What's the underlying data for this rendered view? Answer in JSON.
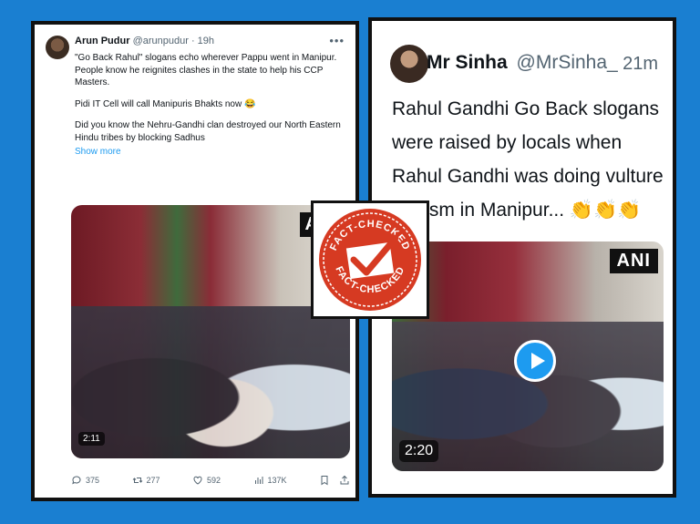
{
  "left_tweet": {
    "name": "Arun Pudur",
    "handle": "@arunpudur",
    "time": "· 19h",
    "more_icon": "more-icon",
    "text_1": "\"Go Back Rahul\" slogans echo wherever Pappu went in Manipur. People know he reignites clashes in the state to help his CCP Masters.",
    "text_2": "Pidi IT Cell will call Manipuris Bhakts now 😂",
    "text_3": "Did you know the Nehru-Gandhi clan destroyed our North Eastern Hindu tribes by blocking Sadhus",
    "show_more": "Show more",
    "video": {
      "watermark": "ANI",
      "duration": "2:11"
    },
    "actions": {
      "replies": "375",
      "retweets": "277",
      "likes": "592",
      "views": "137K"
    }
  },
  "right_tweet": {
    "name": "Mr Sinha",
    "handle": "@MrSinha_",
    "time": "21m",
    "text": "Rahul Gandhi Go Back slogans were raised by locals when Rahul Gandhi was doing vulture tourism in Manipur... 👏👏👏",
    "video": {
      "watermark": "ANI",
      "duration": "2:20",
      "play_icon": "play-icon"
    }
  },
  "stamp": {
    "text_top": "FACT-CHECKED",
    "text_bottom": "FACT-CHECKED",
    "icon": "checkmark-icon"
  },
  "colors": {
    "background": "#1a7fd1",
    "stamp_red": "#d63a22",
    "link_blue": "#1d9bf0"
  }
}
